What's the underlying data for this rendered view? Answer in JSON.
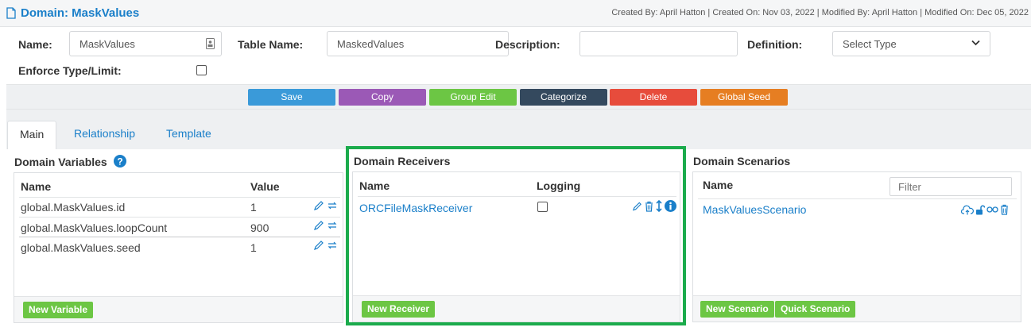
{
  "header": {
    "title": "Domain: MaskValues",
    "meta": "Created By: April Hatton | Created On: Nov 03, 2022 | Modified By: April Hatton | Modified On: Dec 05, 2022"
  },
  "form": {
    "name_label": "Name:",
    "name_value": "MaskValues",
    "table_name_label": "Table Name:",
    "table_name_value": "MaskedValues",
    "description_label": "Description:",
    "description_value": "",
    "definition_label": "Definition:",
    "definition_selected": "Select Type",
    "enforce_label": "Enforce Type/Limit:",
    "enforce_checked": false
  },
  "toolbar": {
    "buttons": [
      {
        "label": "Save",
        "color": "#3a9ad9"
      },
      {
        "label": "Copy",
        "color": "#9b59b6"
      },
      {
        "label": "Group Edit",
        "color": "#6cc644"
      },
      {
        "label": "Categorize",
        "color": "#34495e"
      },
      {
        "label": "Delete",
        "color": "#e74c3c"
      },
      {
        "label": "Global Seed",
        "color": "#e67e22"
      }
    ]
  },
  "tabs": [
    {
      "label": "Main",
      "active": true
    },
    {
      "label": "Relationship",
      "active": false
    },
    {
      "label": "Template",
      "active": false
    }
  ],
  "variables": {
    "title": "Domain Variables",
    "col_name": "Name",
    "col_value": "Value",
    "rows": [
      {
        "name": "global.MaskValues.id",
        "value": "1"
      },
      {
        "name": "global.MaskValues.loopCount",
        "value": "900"
      },
      {
        "name": "global.MaskValues.seed",
        "value": "1"
      }
    ],
    "new_button": "New Variable"
  },
  "receivers": {
    "title": "Domain Receivers",
    "col_name": "Name",
    "col_logging": "Logging",
    "rows": [
      {
        "name": "ORCFileMaskReceiver",
        "logging": false
      }
    ],
    "new_button": "New Receiver"
  },
  "scenarios": {
    "title": "Domain Scenarios",
    "col_name": "Name",
    "filter_placeholder": "Filter",
    "rows": [
      {
        "name": "MaskValuesScenario"
      }
    ],
    "new_button": "New Scenario",
    "quick_button": "Quick Scenario"
  },
  "colors": {
    "link": "#1a7fc9",
    "highlight": "#1bab4c",
    "green_button": "#6cc644"
  }
}
